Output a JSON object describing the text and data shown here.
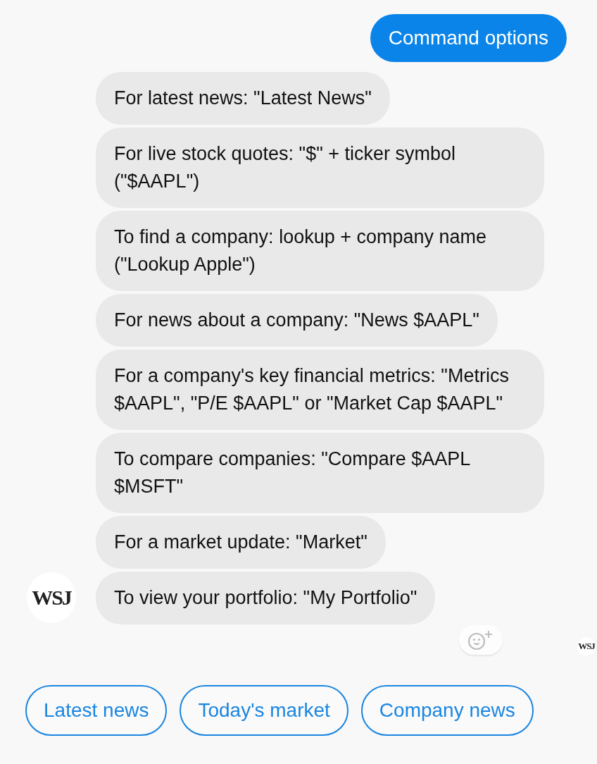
{
  "sent": {
    "text": "Command options"
  },
  "messages": [
    {
      "text": "For latest news: \"Latest News\""
    },
    {
      "text": "For live stock quotes: \"$\" + ticker symbol (\"$AAPL\")"
    },
    {
      "text": "To find a company: lookup + company name (\"Lookup Apple\")"
    },
    {
      "text": "For news about a company: \"News $AAPL\""
    },
    {
      "text": "For a company's key financial metrics: \"Metrics $AAPL\", \"P/E $AAPL\" or \"Market Cap $AAPL\""
    },
    {
      "text": "To compare companies: \"Compare $AAPL $MSFT\""
    },
    {
      "text": "For a market update: \"Market\""
    },
    {
      "text": "To view your portfolio: \"My Portfolio\""
    }
  ],
  "sender": {
    "avatar": "WSJ"
  },
  "read_receipt": {
    "avatar": "WSJ"
  },
  "quick_replies": [
    {
      "label": "Latest news"
    },
    {
      "label": "Today's market"
    },
    {
      "label": "Company news"
    }
  ]
}
